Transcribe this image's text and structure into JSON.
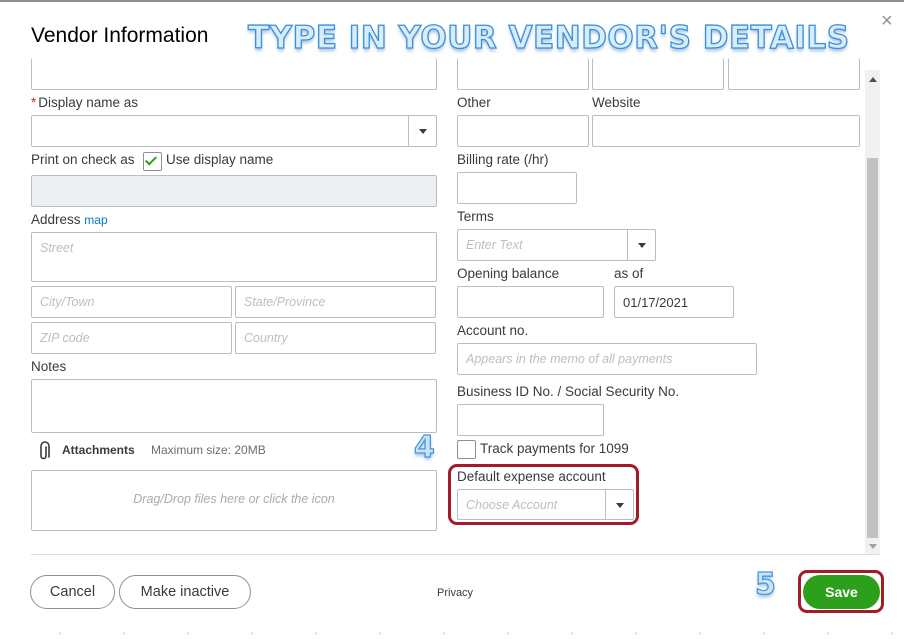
{
  "modal": {
    "title": "Vendor Information",
    "banner": "TYPE IN YOUR VENDOR'S DETAILS",
    "close_glyph": "×"
  },
  "left": {
    "display_name_label": "Display name as",
    "print_on_check_label": "Print on check as",
    "use_display_name_label": "Use display name",
    "use_display_name_checked": true,
    "address_label": "Address",
    "map_link": "map",
    "street_placeholder": "Street",
    "city_placeholder": "City/Town",
    "state_placeholder": "State/Province",
    "zip_placeholder": "ZIP code",
    "country_placeholder": "Country",
    "notes_label": "Notes",
    "attachments_label": "Attachments",
    "max_size_text": "Maximum size: 20MB",
    "dropzone_text": "Drag/Drop files here or click the icon"
  },
  "right": {
    "other_label": "Other",
    "website_label": "Website",
    "billing_rate_label": "Billing rate (/hr)",
    "terms_label": "Terms",
    "terms_placeholder": "Enter Text",
    "opening_balance_label": "Opening balance",
    "as_of_label": "as of",
    "as_of_value": "01/17/2021",
    "account_no_label": "Account no.",
    "account_no_placeholder": "Appears in the memo of all payments",
    "business_id_label": "Business ID No. / Social Security No.",
    "track_1099_label": "Track payments for 1099",
    "track_1099_checked": false,
    "default_expense_label": "Default expense account",
    "default_expense_placeholder": "Choose Account"
  },
  "footer": {
    "cancel_label": "Cancel",
    "make_inactive_label": "Make inactive",
    "privacy_label": "Privacy",
    "save_label": "Save"
  },
  "annotations": {
    "step_4": "4",
    "step_5": "5",
    "highlight_color": "#a11c26"
  },
  "colors": {
    "accent_green": "#2ca01c",
    "link_blue": "#0077c5"
  },
  "icons": {
    "close": "close-icon",
    "attachment": "paperclip-icon",
    "dropdown": "chevron-down-icon",
    "check": "checkmark-icon"
  }
}
